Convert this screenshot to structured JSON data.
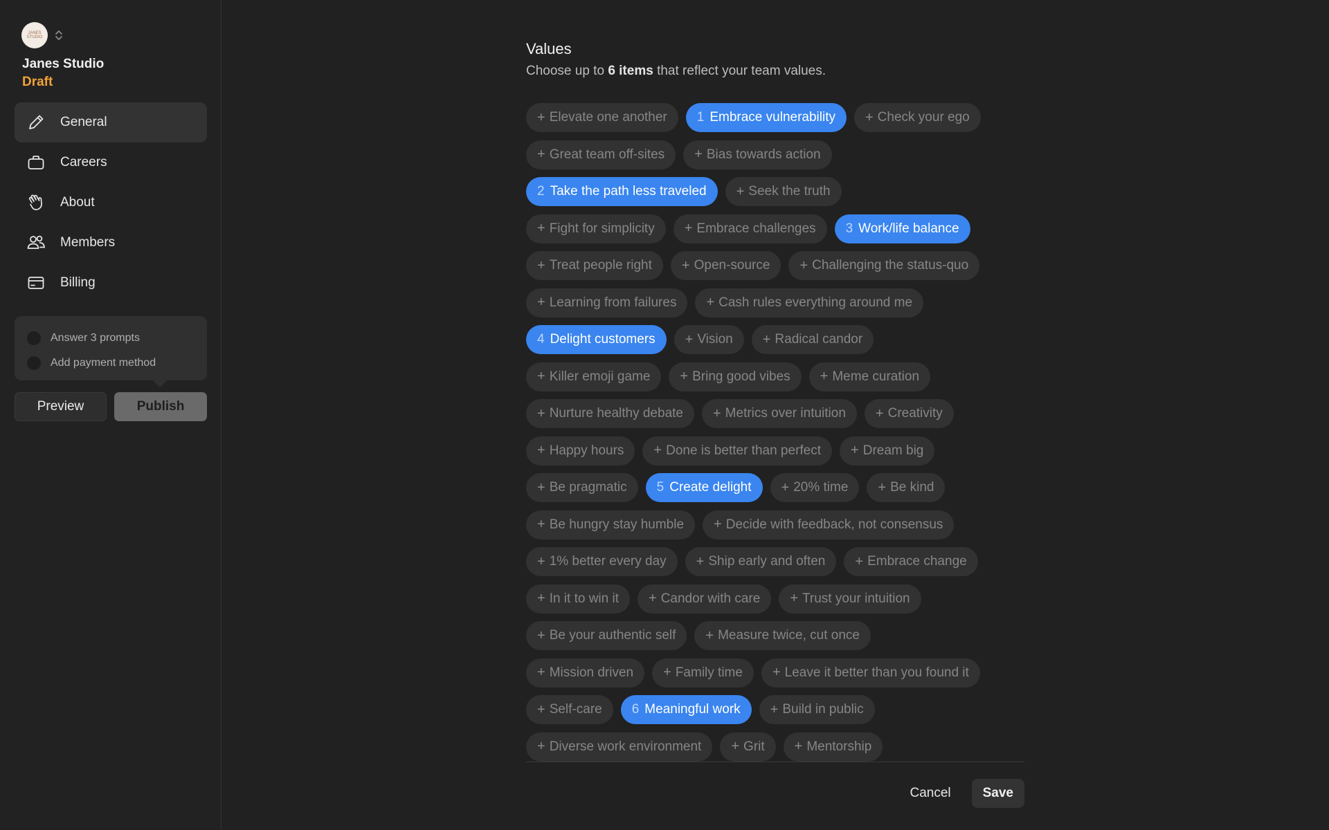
{
  "sidebar": {
    "avatar_text": "JANES STUDIO",
    "org_name": "Janes Studio",
    "org_status": "Draft",
    "nav": [
      {
        "label": "General",
        "icon": "pencil-icon"
      },
      {
        "label": "Careers",
        "icon": "briefcase-icon"
      },
      {
        "label": "About",
        "icon": "hand-wave-icon"
      },
      {
        "label": "Members",
        "icon": "people-icon"
      },
      {
        "label": "Billing",
        "icon": "credit-card-icon"
      }
    ],
    "checklist": [
      "Answer 3 prompts",
      "Add payment method"
    ],
    "preview_label": "Preview",
    "publish_label": "Publish"
  },
  "main": {
    "title": "Values",
    "subtitle_pre": "Choose up to ",
    "subtitle_bold": "6 items",
    "subtitle_post": " that reflect your team values.",
    "rows": [
      [
        {
          "label": "Elevate one another"
        },
        {
          "label": "Embrace vulnerability",
          "order": "1"
        },
        {
          "label": "Check your ego"
        }
      ],
      [
        {
          "label": "Great team off-sites"
        },
        {
          "label": "Bias towards action"
        }
      ],
      [
        {
          "label": "Take the path less traveled",
          "order": "2"
        },
        {
          "label": "Seek the truth"
        }
      ],
      [
        {
          "label": "Fight for simplicity"
        },
        {
          "label": "Embrace challenges"
        },
        {
          "label": "Work/life balance",
          "order": "3"
        }
      ],
      [
        {
          "label": "Treat people right"
        },
        {
          "label": "Open-source"
        },
        {
          "label": "Challenging the status-quo"
        }
      ],
      [
        {
          "label": "Learning from failures"
        },
        {
          "label": "Cash rules everything around me"
        }
      ],
      [
        {
          "label": "Delight customers",
          "order": "4"
        },
        {
          "label": "Vision"
        },
        {
          "label": "Radical candor"
        }
      ],
      [
        {
          "label": "Killer emoji game"
        },
        {
          "label": "Bring good vibes"
        },
        {
          "label": "Meme curation"
        }
      ],
      [
        {
          "label": "Nurture healthy debate"
        },
        {
          "label": "Metrics over intuition"
        },
        {
          "label": "Creativity"
        }
      ],
      [
        {
          "label": "Happy hours"
        },
        {
          "label": "Done is better than perfect"
        },
        {
          "label": "Dream big"
        }
      ],
      [
        {
          "label": "Be pragmatic"
        },
        {
          "label": "Create delight",
          "order": "5"
        },
        {
          "label": "20% time"
        },
        {
          "label": "Be kind"
        }
      ],
      [
        {
          "label": "Be hungry stay humble"
        },
        {
          "label": "Decide with feedback, not consensus"
        }
      ],
      [
        {
          "label": "1% better every day"
        },
        {
          "label": "Ship early and often"
        },
        {
          "label": "Embrace change"
        }
      ],
      [
        {
          "label": "In it to win it"
        },
        {
          "label": "Candor with care"
        },
        {
          "label": "Trust your intuition"
        }
      ],
      [
        {
          "label": "Be your authentic self"
        },
        {
          "label": "Measure twice, cut once"
        }
      ],
      [
        {
          "label": "Mission driven"
        },
        {
          "label": "Family time"
        },
        {
          "label": "Leave it better than you found it"
        }
      ],
      [
        {
          "label": "Self-care"
        },
        {
          "label": "Meaningful work",
          "order": "6"
        },
        {
          "label": "Build in public"
        }
      ],
      [
        {
          "label": "Diverse work environment"
        },
        {
          "label": "Grit"
        },
        {
          "label": "Mentorship"
        }
      ]
    ],
    "cancel_label": "Cancel",
    "save_label": "Save"
  },
  "colors": {
    "accent": "#3a85ef",
    "draft": "#f0a33a",
    "background": "#212121"
  }
}
